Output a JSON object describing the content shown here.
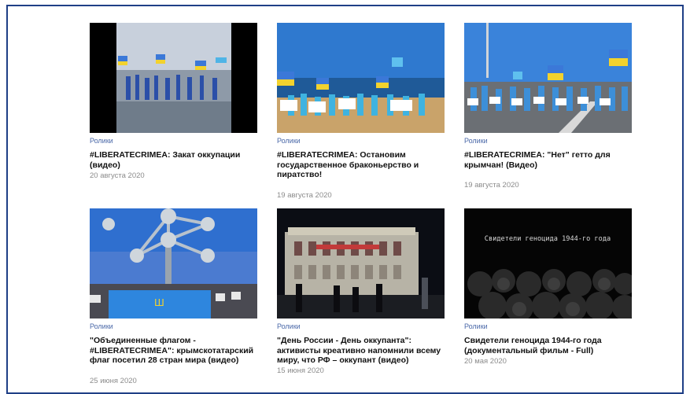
{
  "cards": [
    {
      "category": "Ролики",
      "title": "#LIBERATECRIMEA: Закат оккупации (видео)",
      "date": "20 августа 2020",
      "thumbnail": "video-preview"
    },
    {
      "category": "Ролики",
      "title": "#LIBERATECRIMEA: Остановим государственное браконьерство и пиратство!",
      "date": "19 августа 2020",
      "thumbnail": "video-preview"
    },
    {
      "category": "Ролики",
      "title": "#LIBERATECRIMEA: \"Нет\" гетто для крымчан! (Видео)",
      "date": "19 августа 2020",
      "thumbnail": "video-preview"
    },
    {
      "category": "Ролики",
      "title": "\"Объединенные флагом - #LIBERATECRIMEA\": крымскотатарский флаг посетил 28 стран мира (видео)",
      "date": "25 июня 2020",
      "thumbnail": "video-preview"
    },
    {
      "category": "Ролики",
      "title": "\"День России - День оккупанта\": активисты креативно напомнили всему миру, что РФ – оккупант (видео)",
      "date": "15 июня 2020",
      "thumbnail": "video-preview"
    },
    {
      "category": "Ролики",
      "title": "Свидетели геноцида 1944-го года (документальный фильм - Full)",
      "date": "20 мая 2020",
      "thumbnail": "video-preview",
      "thumbnail_text": "Свидетели геноцида 1944-го года"
    }
  ],
  "colors": {
    "frame": "#1f3f86",
    "category": "#4a68a8",
    "date": "#8b8b8b",
    "title": "#111111"
  }
}
